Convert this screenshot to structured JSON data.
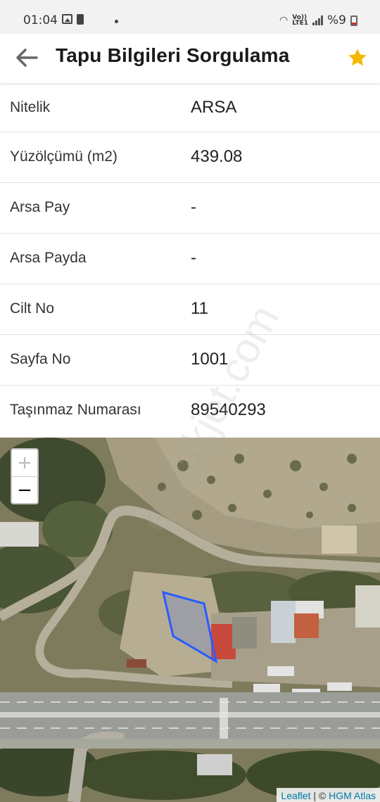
{
  "status_bar": {
    "time": "01:04",
    "battery_text": "%9",
    "lte_top": "Vo))",
    "lte_bottom": "LTE1"
  },
  "app_bar": {
    "title": "Tapu Bilgileri Sorgulama",
    "back_icon": "arrow-left-icon",
    "favorite_icon": "star-icon",
    "favorite_color": "#f5b800"
  },
  "rows": [
    {
      "label": "Nitelik",
      "value": "ARSA"
    },
    {
      "label": "Yüzölçümü (m2)",
      "value": "439.08"
    },
    {
      "label": "Arsa Pay",
      "value": "-"
    },
    {
      "label": "Arsa Payda",
      "value": "-"
    },
    {
      "label": "Cilt No",
      "value": "11"
    },
    {
      "label": "Sayfa No",
      "value": "1001"
    },
    {
      "label": "Taşınmaz Numarası",
      "value": "89540293"
    }
  ],
  "map": {
    "zoom_in": "+",
    "zoom_out": "−",
    "attribution_leaflet": "Leaflet",
    "attribution_sep": " | © ",
    "attribution_source": "HGM Atlas",
    "parcel_color": "#2a5cff"
  },
  "watermark": "emlakjet.com"
}
